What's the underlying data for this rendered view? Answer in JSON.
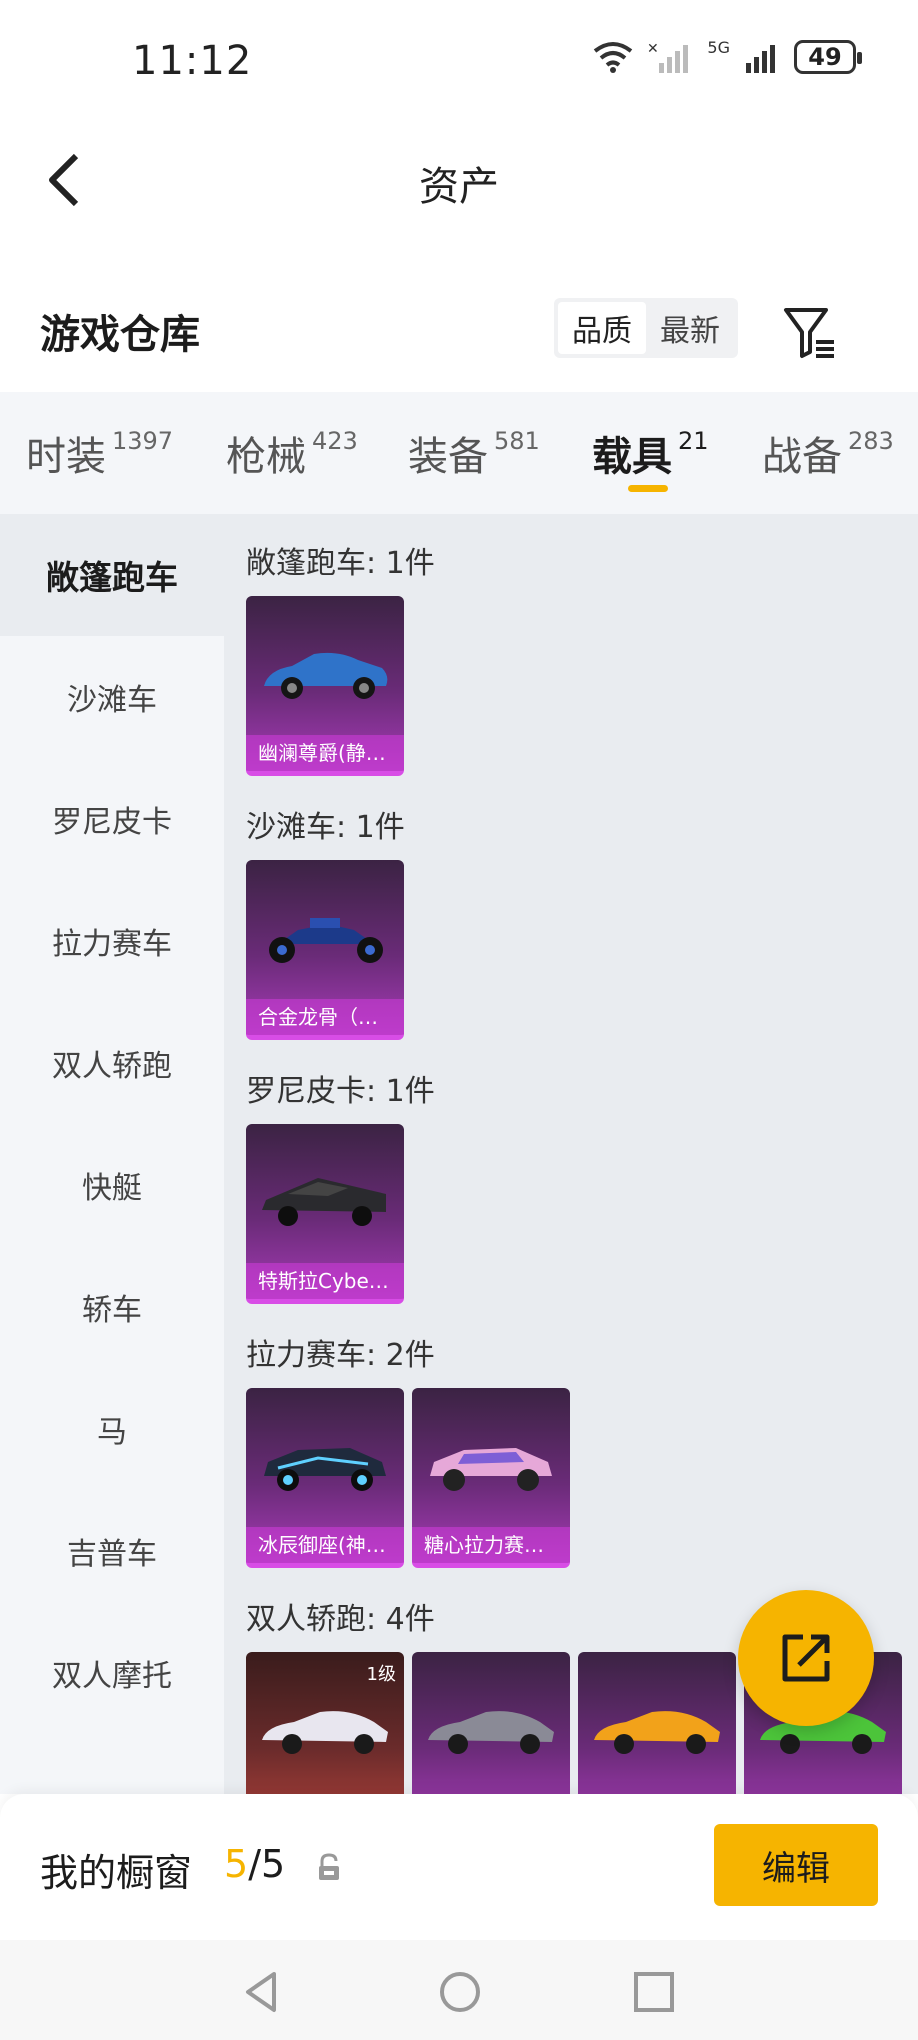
{
  "status_bar": {
    "time": "11:12",
    "network": "5G",
    "battery": "49"
  },
  "header": {
    "title": "资产"
  },
  "warehouse": {
    "title": "游戏仓库",
    "sort_options": [
      "品质",
      "最新"
    ],
    "active_sort": 0
  },
  "categories": [
    {
      "name": "时装",
      "count": "1397"
    },
    {
      "name": "枪械",
      "count": "423"
    },
    {
      "name": "装备",
      "count": "581"
    },
    {
      "name": "载具",
      "count": "21"
    },
    {
      "name": "战备",
      "count": "283"
    }
  ],
  "active_category": 3,
  "side_nav": [
    "敞篷跑车",
    "沙滩车",
    "罗尼皮卡",
    "拉力赛车",
    "双人轿跑",
    "快艇",
    "轿车",
    "马",
    "吉普车",
    "双人摩托"
  ],
  "active_side": 0,
  "groups": [
    {
      "title": "敞篷跑车: 1件",
      "items": [
        {
          "label": "幽澜尊爵(静…",
          "color": "#2f73c9"
        }
      ]
    },
    {
      "title": "沙滩车: 1件",
      "items": [
        {
          "label": "合金龙骨（…",
          "color": "#1c3a8a"
        }
      ]
    },
    {
      "title": "罗尼皮卡: 1件",
      "items": [
        {
          "label": "特斯拉Cybe…",
          "color": "#2a2a2e"
        }
      ]
    },
    {
      "title": "拉力赛车: 2件",
      "items": [
        {
          "label": "冰辰御座(神…",
          "color": "#1f2a3d"
        },
        {
          "label": "糖心拉力赛…",
          "color": "#e6a8d8"
        }
      ]
    },
    {
      "title": "双人轿跑: 4件",
      "items": [
        {
          "label": "",
          "color": "#e8e6ef",
          "level": "1级",
          "red": true
        },
        {
          "label": "",
          "color": "#8a8a96"
        },
        {
          "label": "",
          "color": "#f2a21a"
        },
        {
          "label": "",
          "color": "#4cc43a"
        }
      ]
    }
  ],
  "bottom_bar": {
    "title": "我的橱窗",
    "current": "5",
    "total": "/5",
    "edit_label": "编辑"
  }
}
